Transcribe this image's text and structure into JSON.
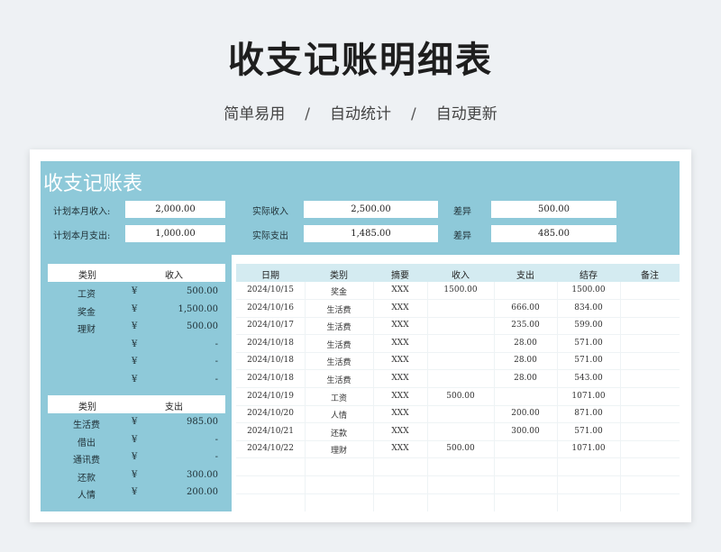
{
  "title": "收支记账明细表",
  "subtitle": [
    "简单易用",
    "自动统计",
    "自动更新"
  ],
  "subtitle_sep": "/",
  "sheet_title": "收支记账表",
  "summary": {
    "plan_income_label": "计划本月收入:",
    "plan_income_value": "2,000.00",
    "plan_expense_label": "计划本月支出:",
    "plan_expense_value": "1,000.00",
    "actual_income_label": "实际收入",
    "actual_income_value": "2,500.00",
    "actual_expense_label": "实际支出",
    "actual_expense_value": "1,485.00",
    "diff_label_1": "差异",
    "diff_value_1": "500.00",
    "diff_label_2": "差异",
    "diff_value_2": "485.00"
  },
  "income_table": {
    "headers": [
      "类别",
      "收入"
    ],
    "rows": [
      {
        "cat": "工资",
        "cur": "¥",
        "amt": "500.00"
      },
      {
        "cat": "奖金",
        "cur": "¥",
        "amt": "1,500.00"
      },
      {
        "cat": "理财",
        "cur": "¥",
        "amt": "500.00"
      },
      {
        "cat": "",
        "cur": "¥",
        "amt": "-"
      },
      {
        "cat": "",
        "cur": "¥",
        "amt": "-"
      },
      {
        "cat": "",
        "cur": "¥",
        "amt": "-"
      }
    ]
  },
  "expense_table": {
    "headers": [
      "类别",
      "支出"
    ],
    "rows": [
      {
        "cat": "生活费",
        "cur": "¥",
        "amt": "985.00"
      },
      {
        "cat": "借出",
        "cur": "¥",
        "amt": "-"
      },
      {
        "cat": "通讯费",
        "cur": "¥",
        "amt": "-"
      },
      {
        "cat": "还款",
        "cur": "¥",
        "amt": "300.00"
      },
      {
        "cat": "人情",
        "cur": "¥",
        "amt": "200.00"
      }
    ]
  },
  "ledger": {
    "headers": [
      "日期",
      "类别",
      "摘要",
      "收入",
      "支出",
      "结存",
      "备注"
    ],
    "rows": [
      [
        "2024/10/15",
        "奖金",
        "XXX",
        "1500.00",
        "",
        "1500.00",
        ""
      ],
      [
        "2024/10/16",
        "生活费",
        "XXX",
        "",
        "666.00",
        "834.00",
        ""
      ],
      [
        "2024/10/17",
        "生活费",
        "XXX",
        "",
        "235.00",
        "599.00",
        ""
      ],
      [
        "2024/10/18",
        "生活费",
        "XXX",
        "",
        "28.00",
        "571.00",
        ""
      ],
      [
        "2024/10/18",
        "生活费",
        "XXX",
        "",
        "28.00",
        "571.00",
        ""
      ],
      [
        "2024/10/18",
        "生活费",
        "XXX",
        "",
        "28.00",
        "543.00",
        ""
      ],
      [
        "2024/10/19",
        "工资",
        "XXX",
        "500.00",
        "",
        "1071.00",
        ""
      ],
      [
        "2024/10/20",
        "人情",
        "XXX",
        "",
        "200.00",
        "871.00",
        ""
      ],
      [
        "2024/10/21",
        "还款",
        "XXX",
        "",
        "300.00",
        "571.00",
        ""
      ],
      [
        "2024/10/22",
        "理财",
        "XXX",
        "500.00",
        "",
        "1071.00",
        ""
      ],
      [
        "",
        "",
        "",
        "",
        "",
        "",
        ""
      ],
      [
        "",
        "",
        "",
        "",
        "",
        "",
        ""
      ]
    ]
  }
}
